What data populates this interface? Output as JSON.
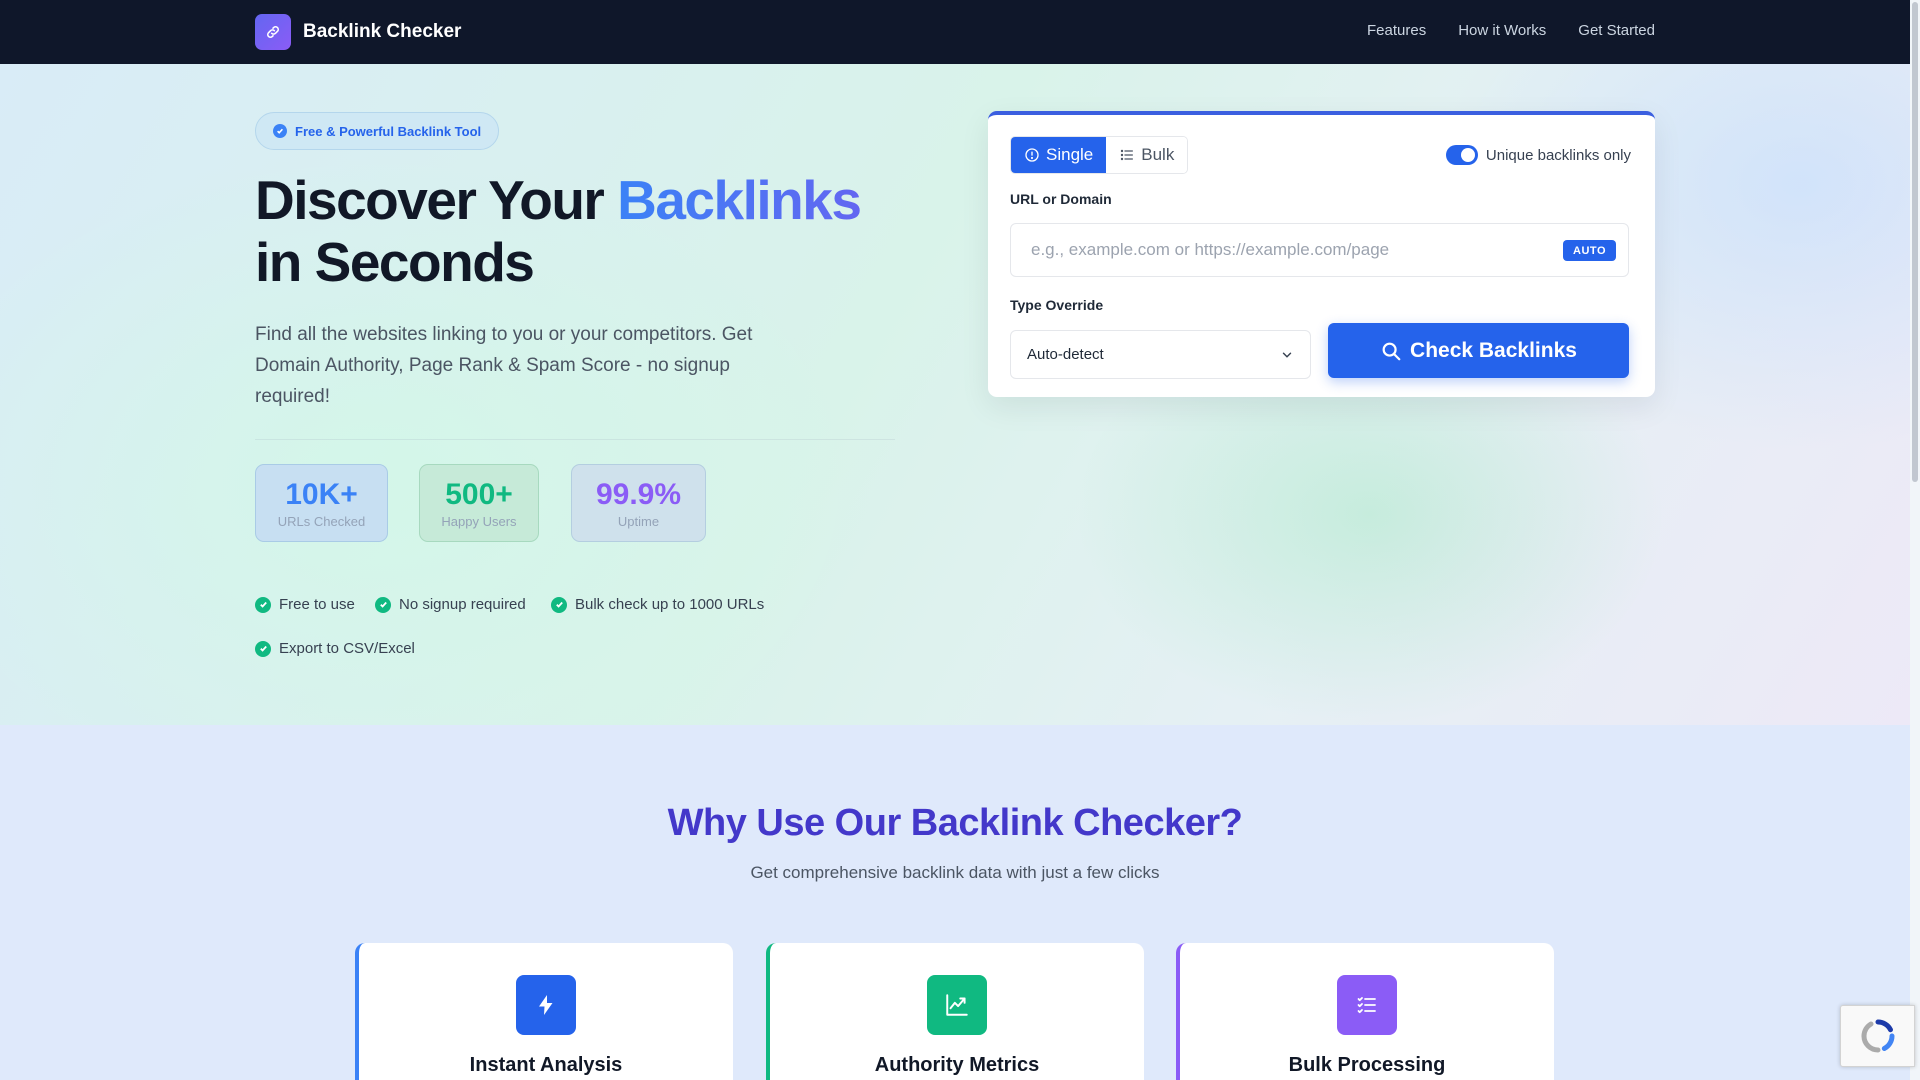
{
  "nav": {
    "brand": "Backlink Checker",
    "links": [
      "Features",
      "How it Works",
      "Get Started"
    ]
  },
  "hero": {
    "badge": "Free & Powerful Backlink Tool",
    "title_line1_a": "Discover Your ",
    "title_line1_accent": "Backlinks",
    "title_line2": "in Seconds",
    "subtitle": "Find all the websites linking to you or your competitors. Get Domain Authority, Page Rank & Spam Score - no signup required!",
    "stats": [
      {
        "value": "10K+",
        "label": "URLs Checked"
      },
      {
        "value": "500+",
        "label": "Happy Users"
      },
      {
        "value": "99.9%",
        "label": "Uptime"
      }
    ],
    "checks": [
      "Free to use",
      "No signup required",
      "Bulk check up to 1000 URLs",
      "Export to CSV/Excel"
    ]
  },
  "form": {
    "tab_single": "Single",
    "tab_bulk": "Bulk",
    "toggle_label": "Unique backlinks only",
    "toggle_on": true,
    "url_label": "URL or Domain",
    "url_placeholder": "e.g., example.com or https://example.com/page",
    "url_value": "",
    "auto_badge": "AUTO",
    "type_label": "Type Override",
    "type_value": "Auto-detect",
    "submit": "Check Backlinks"
  },
  "why": {
    "title": "Why Use Our Backlink Checker?",
    "subtitle": "Get comprehensive backlink data with just a few clicks",
    "cards": [
      {
        "title": "Instant Analysis",
        "icon": "lightning-icon"
      },
      {
        "title": "Authority Metrics",
        "icon": "trending-chart-icon"
      },
      {
        "title": "Bulk Processing",
        "icon": "checklist-icon"
      }
    ]
  },
  "colors": {
    "nav_bg": "#0f172a",
    "primary": "#2563eb",
    "green": "#10b981",
    "purple": "#8b5cf6"
  }
}
